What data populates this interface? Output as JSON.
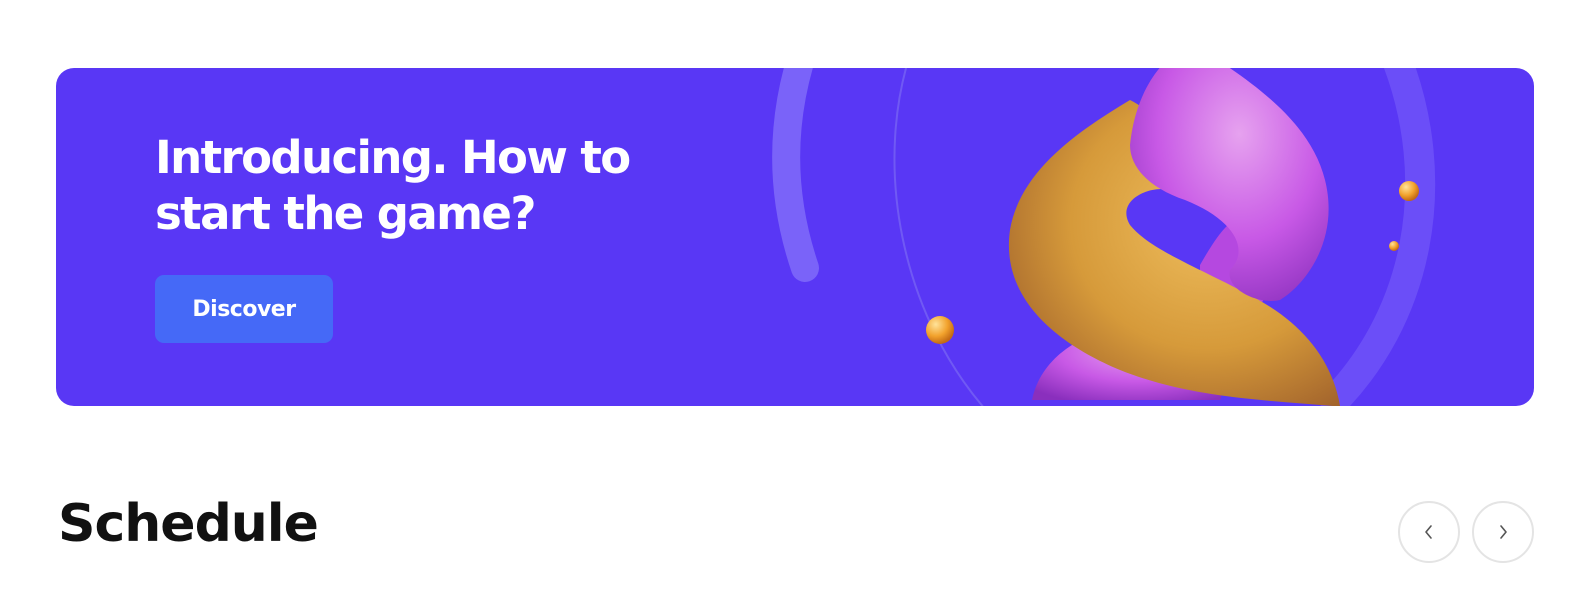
{
  "banner": {
    "title": "Introducing. How to start the game?",
    "button_label": "Discover",
    "background_color": "#5937f5",
    "button_color": "#4569f7"
  },
  "schedule": {
    "title": "Schedule",
    "prev_icon": "chevron-left-icon",
    "next_icon": "chevron-right-icon"
  }
}
